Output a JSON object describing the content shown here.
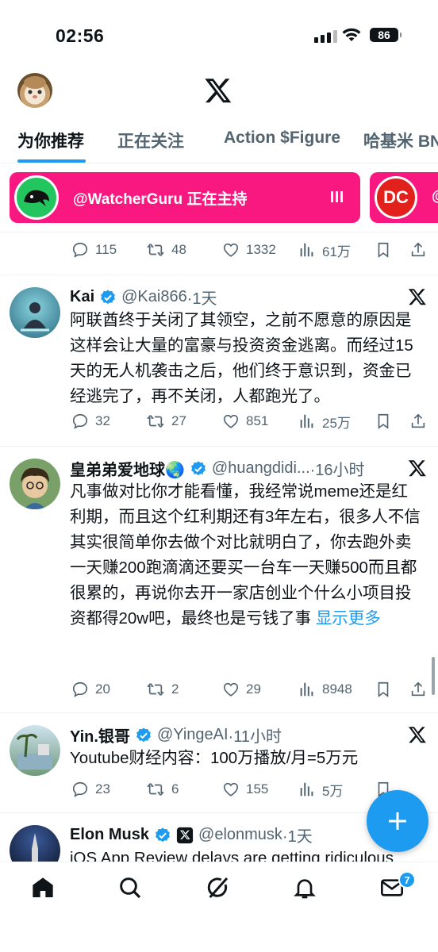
{
  "status": {
    "time": "02:56",
    "battery": "86"
  },
  "header": {
    "logo": "x-logo"
  },
  "tabs": [
    "为你推荐",
    "正在关注",
    "Action $Figure",
    "哈基米 BN"
  ],
  "spaces": [
    {
      "host": "@WatcherGuru 正在主持"
    },
    {
      "badge_text": "DC",
      "host_partial": "@"
    }
  ],
  "first_actions": {
    "replies": "115",
    "retweets": "48",
    "likes": "1332",
    "views": "61万"
  },
  "tweets": [
    {
      "name": "Kai",
      "handle": "@Kai866",
      "time": "·1天",
      "text": "阿联酋终于关闭了其领空，之前不愿意的原因是这样会让大量的富豪与投资资金逃离。而经过15天的无人机袭击之后，他们终于意识到，资金已经逃完了，再不关闭，人都跑光了。",
      "replies": "32",
      "retweets": "27",
      "likes": "851",
      "views": "25万"
    },
    {
      "name": "皇弟弟爱地球🌏",
      "handle": "@huangdidi...",
      "time": "·16小时",
      "text": "凡事做对比你才能看懂，我经常说meme还是红利期，而且这个红利期还有3年左右，很多人不信\n其实很简单你去做个对比就明白了，你去跑外卖一天赚200跑滴滴还要买一台车一天赚500而且都很累的，再说你去开一家店创业个什么小项目投资都得20w吧，最终也是亏钱了事 ",
      "more": "显示更多",
      "replies": "20",
      "retweets": "2",
      "likes": "29",
      "views": "8948"
    },
    {
      "name": "Yin.银哥",
      "handle": "@YingeAI",
      "time": "·11小时",
      "text": "Youtube财经内容：100万播放/月=5万元",
      "replies": "23",
      "retweets": "6",
      "likes": "155",
      "views": "5万"
    },
    {
      "name": "Elon Musk",
      "handle": "@elonmusk",
      "time": "·1天",
      "text": "iOS App Review delays are getting ridiculous"
    }
  ],
  "nav": [
    "home-icon",
    "search-icon",
    "grok-icon",
    "notifications-icon",
    "messages-icon"
  ],
  "messages_badge": "7",
  "colors": {
    "accent": "#1d9bf0",
    "spaces": "#f91880"
  }
}
